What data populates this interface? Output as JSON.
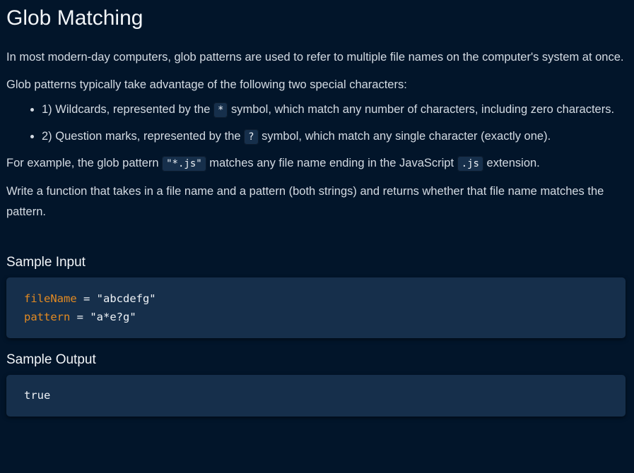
{
  "title": "Glob Matching",
  "paragraphs": {
    "intro": "In most modern-day computers, glob patterns are used to refer to multiple file names on the computer's system at once.",
    "lead": "Glob patterns typically take advantage of the following two special characters:",
    "example_pre": "For example, the glob pattern ",
    "example_code1": "\"*.js\"",
    "example_mid": " matches any file name ending in the JavaScript ",
    "example_code2": ".js",
    "example_post": " extension.",
    "task": "Write a function that takes in a file name and a pattern (both strings) and returns whether that file name matches the pattern."
  },
  "bullets": [
    {
      "pre": "1) Wildcards, represented by the ",
      "code": "*",
      "post": " symbol, which match any number of characters, including zero characters."
    },
    {
      "pre": "2) Question marks, represented by the ",
      "code": "?",
      "post": " symbol, which match any single character (exactly one)."
    }
  ],
  "sample_input": {
    "heading": "Sample Input",
    "lines": [
      {
        "name": "fileName",
        "op": " = ",
        "value": "\"abcdefg\""
      },
      {
        "name": "pattern",
        "op": " = ",
        "value": "\"a*e?g\""
      }
    ]
  },
  "sample_output": {
    "heading": "Sample Output",
    "value": "true"
  },
  "colors": {
    "background": "#02152a",
    "code_bg": "#162f4b",
    "variable": "#e28a22"
  }
}
